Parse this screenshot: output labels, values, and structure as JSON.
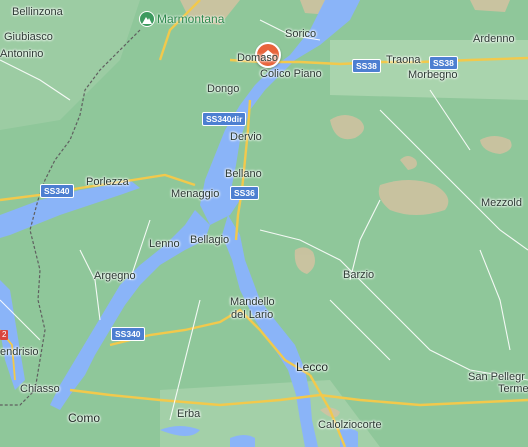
{
  "map": {
    "colors": {
      "land": "#8fc79a",
      "water": "#8ab4f8",
      "highland": "#d9c7a6",
      "road": "#f2c94c",
      "minor_road": "#ffffff",
      "border": "#6b6b6b",
      "shield": "#4d7fd1"
    },
    "places": {
      "bellinzona": "Bellinzona",
      "giubiasco": "Giubiasco",
      "antonino": "Antonino",
      "sorico": "Sorico",
      "domaso": "Domaso",
      "colico_piano": "Colico Piano",
      "traona": "Traona",
      "ardenno": "Ardenno",
      "morbegno": "Morbegno",
      "dongo": "Dongo",
      "dervio": "Dervio",
      "bellano": "Bellano",
      "porlezza": "Porlezza",
      "menaggio": "Menaggio",
      "lenno": "Lenno",
      "bellagio": "Bellagio",
      "mezzoldo": "Mezzold",
      "barzio": "Barzio",
      "argegno": "Argegno",
      "mandello": "Mandello",
      "del_lario": "del Lario",
      "mendrisio": "endrisio",
      "chiasso": "Chiasso",
      "lecco": "Lecco",
      "como": "Como",
      "erba": "Erba",
      "calolziocorte": "Calolziocorte",
      "san_pellegrino_1": "San Pellegr",
      "san_pellegrino_2": "Terme"
    },
    "poi": {
      "marmontana": "Marmontana"
    },
    "roads": {
      "ss38_a": "SS38",
      "ss38_b": "SS38",
      "ss340dir": "SS340dir",
      "ss36": "SS36",
      "ss340_a": "SS340",
      "ss340_b": "SS340",
      "tag_2": "2"
    },
    "icons": {
      "poi": "mountain-peak-icon",
      "home": "home-pin-icon"
    }
  }
}
